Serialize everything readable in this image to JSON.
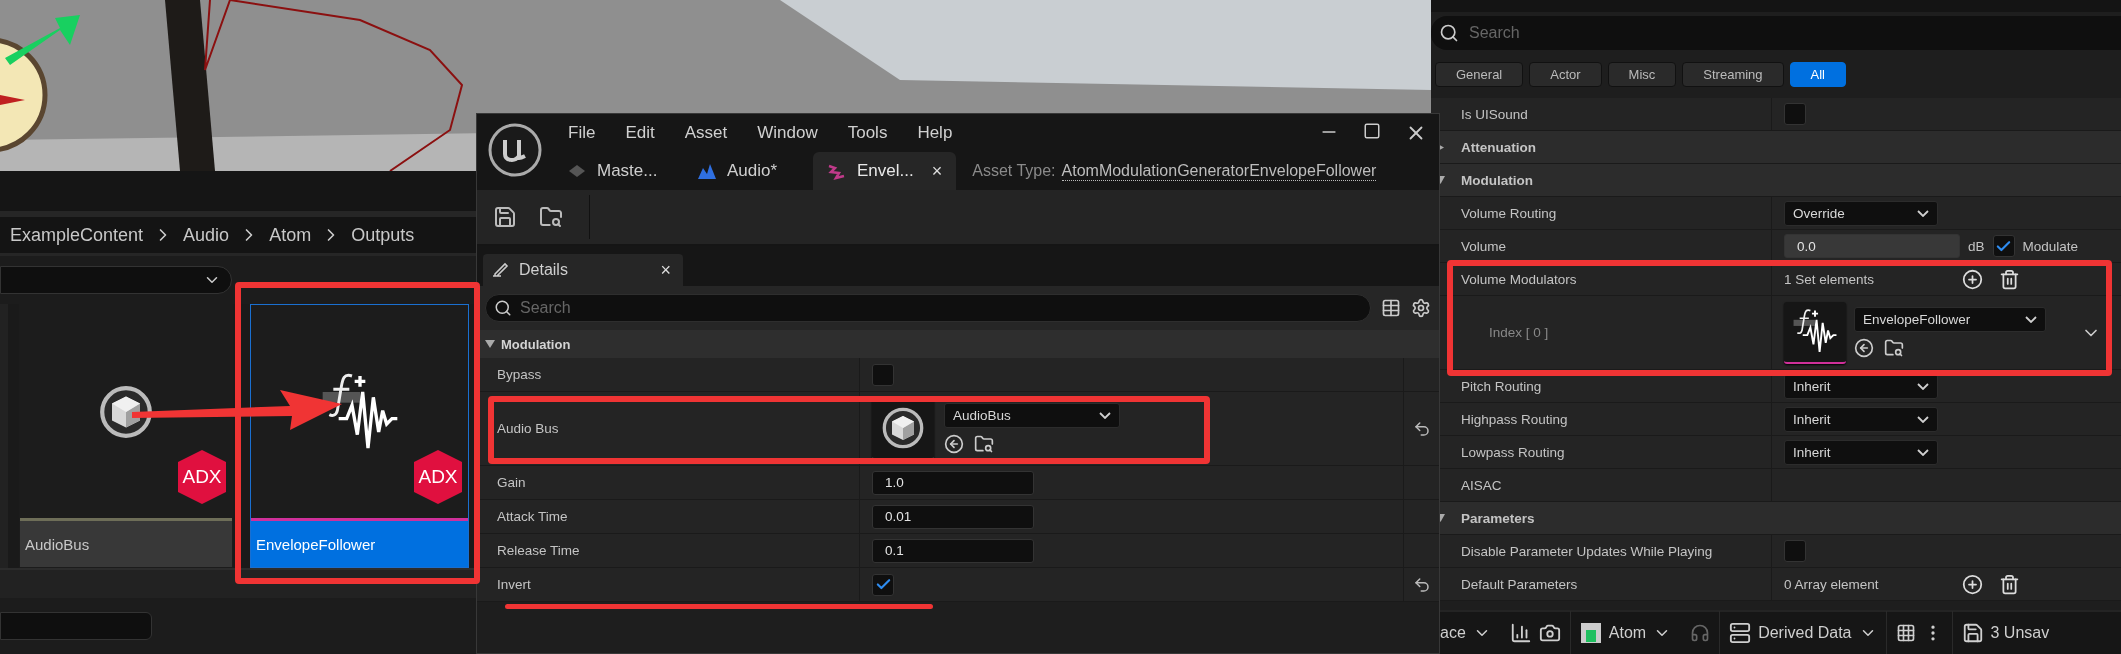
{
  "content_browser": {
    "breadcrumb": [
      "ExampleContent",
      "Audio",
      "Atom",
      "Outputs"
    ],
    "assets": [
      {
        "name": "AudioBus",
        "kind": "bus",
        "badge": "ADX",
        "color": "#6e6e58",
        "selected": false
      },
      {
        "name": "EnvelopeFollower",
        "kind": "envelope",
        "badge": "ADX",
        "color": "#d0309a",
        "selected": true
      }
    ]
  },
  "asset_editor": {
    "menu": [
      "File",
      "Edit",
      "Asset",
      "Window",
      "Tools",
      "Help"
    ],
    "tabs": [
      {
        "label": "Maste...",
        "kind": "master",
        "selected": false
      },
      {
        "label": "Audio*",
        "kind": "audio",
        "selected": false
      },
      {
        "label": "Envel...",
        "kind": "envelope",
        "selected": true,
        "close": "×"
      }
    ],
    "asset_type_label": "Asset Type:",
    "asset_type": "AtomModulationGeneratorEnvelopeFollower",
    "panel_tab": {
      "label": "Details",
      "close": "×"
    },
    "search": {
      "placeholder": "Search"
    },
    "section": "Modulation",
    "rows": [
      {
        "kind": "checkbox",
        "label": "Bypass",
        "checked": false,
        "reset": false
      },
      {
        "kind": "asset",
        "label": "Audio Bus",
        "value": "AudioBus",
        "reset": true
      },
      {
        "kind": "number",
        "label": "Gain",
        "value": "1.0",
        "reset": false
      },
      {
        "kind": "number",
        "label": "Attack Time",
        "value": "0.01",
        "reset": false
      },
      {
        "kind": "number",
        "label": "Release Time",
        "value": "0.1",
        "reset": false
      },
      {
        "kind": "checkbox",
        "label": "Invert",
        "checked": true,
        "reset": true
      }
    ]
  },
  "details_panel": {
    "search": {
      "placeholder": "Search"
    },
    "filters": [
      {
        "label": "General",
        "selected": false
      },
      {
        "label": "Actor",
        "selected": false
      },
      {
        "label": "Misc",
        "selected": false
      },
      {
        "label": "Streaming",
        "selected": false
      },
      {
        "label": "All",
        "selected": true
      }
    ],
    "rows": [
      {
        "kind": "checkbox",
        "label": "Is UISound",
        "checked": false
      },
      {
        "kind": "category",
        "label": "Attenuation",
        "expanded": false
      },
      {
        "kind": "category",
        "label": "Modulation",
        "expanded": true
      },
      {
        "kind": "dropdown",
        "label": "Volume Routing",
        "value": "Override"
      },
      {
        "kind": "volume",
        "label": "Volume",
        "value": "0.0",
        "unit": "dB",
        "checked": true,
        "option": "Modulate"
      },
      {
        "kind": "array",
        "label": "Volume Modulators",
        "count": "1 Set elements"
      },
      {
        "kind": "element",
        "label": "Index [ 0 ]",
        "value": "EnvelopeFollower"
      },
      {
        "kind": "dropdown",
        "label": "Pitch Routing",
        "value": "Inherit"
      },
      {
        "kind": "dropdown",
        "label": "Highpass Routing",
        "value": "Inherit"
      },
      {
        "kind": "dropdown",
        "label": "Lowpass Routing",
        "value": "Inherit"
      },
      {
        "kind": "plain",
        "label": "AISAC"
      },
      {
        "kind": "category",
        "label": "Parameters",
        "expanded": true
      },
      {
        "kind": "checkbox",
        "label": "Disable Parameter Updates While Playing",
        "checked": false
      },
      {
        "kind": "array",
        "label": "Default Parameters",
        "count": "0 Array element"
      }
    ]
  },
  "status_bar": [
    {
      "kind": "dropdown",
      "label": "ace"
    },
    {
      "kind": "atom",
      "label": "Atom"
    },
    {
      "kind": "derived",
      "label": "Derived Data"
    },
    {
      "kind": "unsaved",
      "label": "3 Unsav"
    }
  ]
}
